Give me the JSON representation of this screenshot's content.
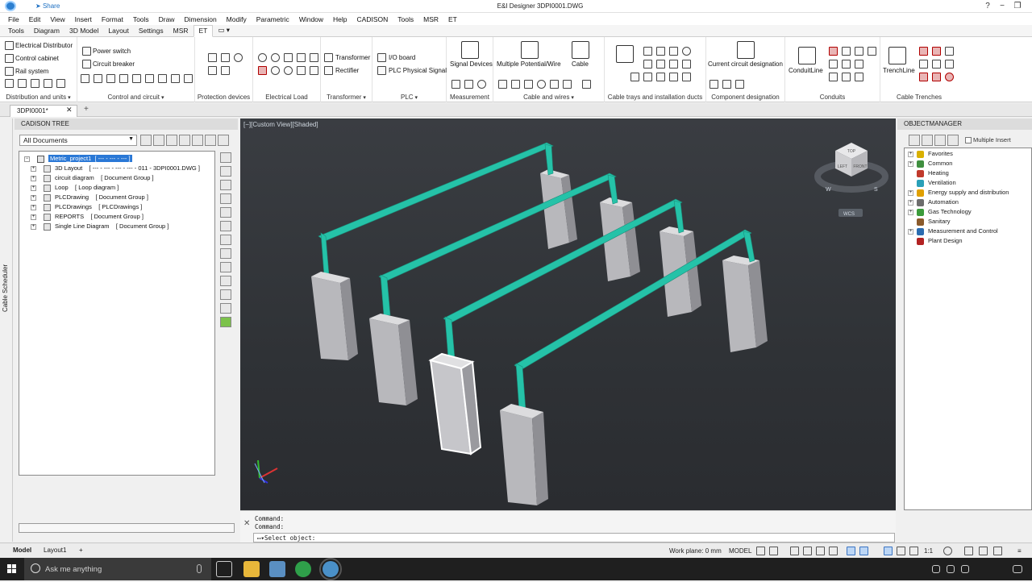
{
  "window": {
    "title": "E&I Designer    3DPI0001.DWG",
    "share_label": "Share"
  },
  "menu": [
    "File",
    "Edit",
    "View",
    "Insert",
    "Format",
    "Tools",
    "Draw",
    "Dimension",
    "Modify",
    "Parametric",
    "Window",
    "Help",
    "CADISON",
    "Tools",
    "MSR",
    "ET"
  ],
  "ribbon_tabs": [
    "Tools",
    "Diagram",
    "3D Model",
    "Layout",
    "Settings",
    "MSR",
    "ET"
  ],
  "ribbon_active_tab": "ET",
  "ribbon": {
    "distribution": {
      "items": [
        "Electrical Distributor",
        "Control cabinet",
        "Rail system"
      ],
      "label": "Distribution and units"
    },
    "control": {
      "items": [
        "Power switch",
        "Circuit breaker"
      ],
      "label": "Control and circuit"
    },
    "protection": {
      "label": "Protection devices"
    },
    "load": {
      "label": "Electrical Load"
    },
    "transformer": {
      "items": [
        "Transformer",
        "Rectifier"
      ],
      "label": "Transformer"
    },
    "plc": {
      "items": [
        "I/O board",
        "PLC Physical Signal"
      ],
      "label": "PLC"
    },
    "measurement": {
      "big": "Signal Devices",
      "label": "Measurement"
    },
    "cable": {
      "big1": "Multiple Potential/Wire",
      "big2": "Cable",
      "label": "Cable and wires"
    },
    "trays": {
      "label": "Cable trays and installation ducts"
    },
    "component": {
      "big": "Current circuit designation",
      "label": "Component designation"
    },
    "conduits": {
      "big": "ConduitLine",
      "label": "Conduits"
    },
    "trenches": {
      "big": "TrenchLine",
      "label": "Cable Trenches"
    }
  },
  "doc_tab": {
    "name": "3DPI0001*"
  },
  "left_strip_label": "Cable Scheduler",
  "tree": {
    "title": "CADISON TREE",
    "filter_value": "All Documents",
    "items": [
      {
        "label": "Metric_project1",
        "extra": "[ --- - --- - --- ]"
      },
      {
        "label": "3D Layout",
        "extra": "[ --- - --- - --- - --- - 011 - 3DPI0001.DWG ]"
      },
      {
        "label": "circuit diagram",
        "extra": "[ Document Group ]"
      },
      {
        "label": "Loop",
        "extra": "[ Loop diagram ]"
      },
      {
        "label": "PLCDrawing",
        "extra": "[ Document Group ]"
      },
      {
        "label": "PLCDrawings",
        "extra": "[ PLCDrawings ]"
      },
      {
        "label": "REPORTS",
        "extra": "[ Document Group ]"
      },
      {
        "label": "Single Line Diagram",
        "extra": "[ Document Group ]"
      }
    ]
  },
  "viewport": {
    "label": "[−][Custom View][Shaded]",
    "viewcube": {
      "top": "TOP",
      "left": "LEFT",
      "front": "FRONT",
      "west": "W",
      "south": "S",
      "wcs": "WCS"
    }
  },
  "object_manager": {
    "title": "OBJECTMANAGER",
    "multiple_insert_label": "Multiple Insert",
    "items": [
      {
        "label": "Favorites",
        "color": "#d9b000"
      },
      {
        "label": "Common",
        "color": "#3f8f3f"
      },
      {
        "label": "Heating",
        "color": "#c0392b"
      },
      {
        "label": "Ventilation",
        "color": "#2aa0b8"
      },
      {
        "label": "Energy supply and distribution",
        "color": "#e0a000"
      },
      {
        "label": "Automation",
        "color": "#6c6c6c"
      },
      {
        "label": "Gas Technology",
        "color": "#3b9b3b"
      },
      {
        "label": "Sanitary",
        "color": "#8a5a2b"
      },
      {
        "label": "Measurement and Control",
        "color": "#2b6cb0"
      },
      {
        "label": "Plant Design",
        "color": "#b22222"
      }
    ]
  },
  "command": {
    "line1": "Command:",
    "line2": "Command:",
    "prompt": "Select object:"
  },
  "layout_tabs": [
    "Model",
    "Layout1"
  ],
  "status": {
    "workplane": "Work plane: 0 mm",
    "space": "MODEL",
    "scale": "1:1"
  },
  "taskbar": {
    "search_placeholder": "Ask me anything"
  },
  "colors": {
    "tray": "#25c2a8",
    "cabinet": "#c9c9cc",
    "selection": "#ffffff",
    "viewport_bg": "#33363a",
    "accent": "#2a78d6"
  }
}
